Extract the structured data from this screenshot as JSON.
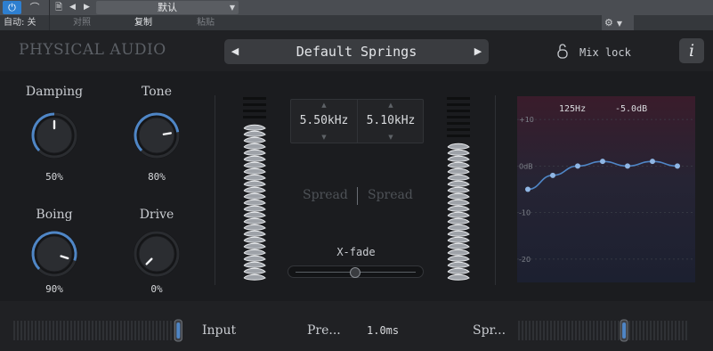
{
  "host": {
    "power_icon": "power-icon",
    "arc_icon": "compare-arc-icon",
    "doc_icon": "document-icon",
    "preset_value": "默认",
    "auto_off": "自动: 关",
    "compare": "对照",
    "copy": "复制",
    "paste": "粘贴",
    "settings_icon": "gear-icon"
  },
  "plugin": {
    "brand": "PHYSICAL AUDIO",
    "preset_name": "Default Springs",
    "mix_lock": "Mix lock",
    "info": "i",
    "knobs": [
      {
        "label": "Damping",
        "value": "50%",
        "fraction": 0.5
      },
      {
        "label": "Tone",
        "value": "80%",
        "fraction": 0.8
      },
      {
        "label": "Boing",
        "value": "90%",
        "fraction": 0.9
      },
      {
        "label": "Drive",
        "value": "0%",
        "fraction": 0.0
      }
    ],
    "freq_left": "5.50kHz",
    "freq_right": "5.10kHz",
    "spread_left": "Spread",
    "spread_right": "Spread",
    "xfade_label": "X-fade",
    "xfade_fraction": 0.5,
    "eq": {
      "freq_readout": "125Hz",
      "gain_readout": "-5.0dB",
      "grid_labels": [
        "+10",
        "0dB",
        "-10",
        "-20"
      ]
    },
    "bottom": {
      "input_label": "Input",
      "input_fraction": 0.98,
      "pre_label": "Pre...",
      "pre_value": "1.0ms",
      "spr_label": "Spr...",
      "spr_fraction": 0.62
    }
  },
  "colors": {
    "accent": "#4f86c6",
    "eq_curve": "#4f86c6",
    "eq_top": "#3a1c2b",
    "eq_bottom": "#1e2232"
  },
  "chart_data": {
    "type": "line",
    "title": "",
    "xlabel": "",
    "ylabel": "",
    "ylim": [
      -25,
      15
    ],
    "y_ticks": [
      "+10",
      "0dB",
      "-10",
      "-20"
    ],
    "series": [
      {
        "values": [
          -5.0,
          -2.0,
          0.0,
          1.0,
          0.0,
          1.0,
          0.0
        ]
      }
    ]
  }
}
